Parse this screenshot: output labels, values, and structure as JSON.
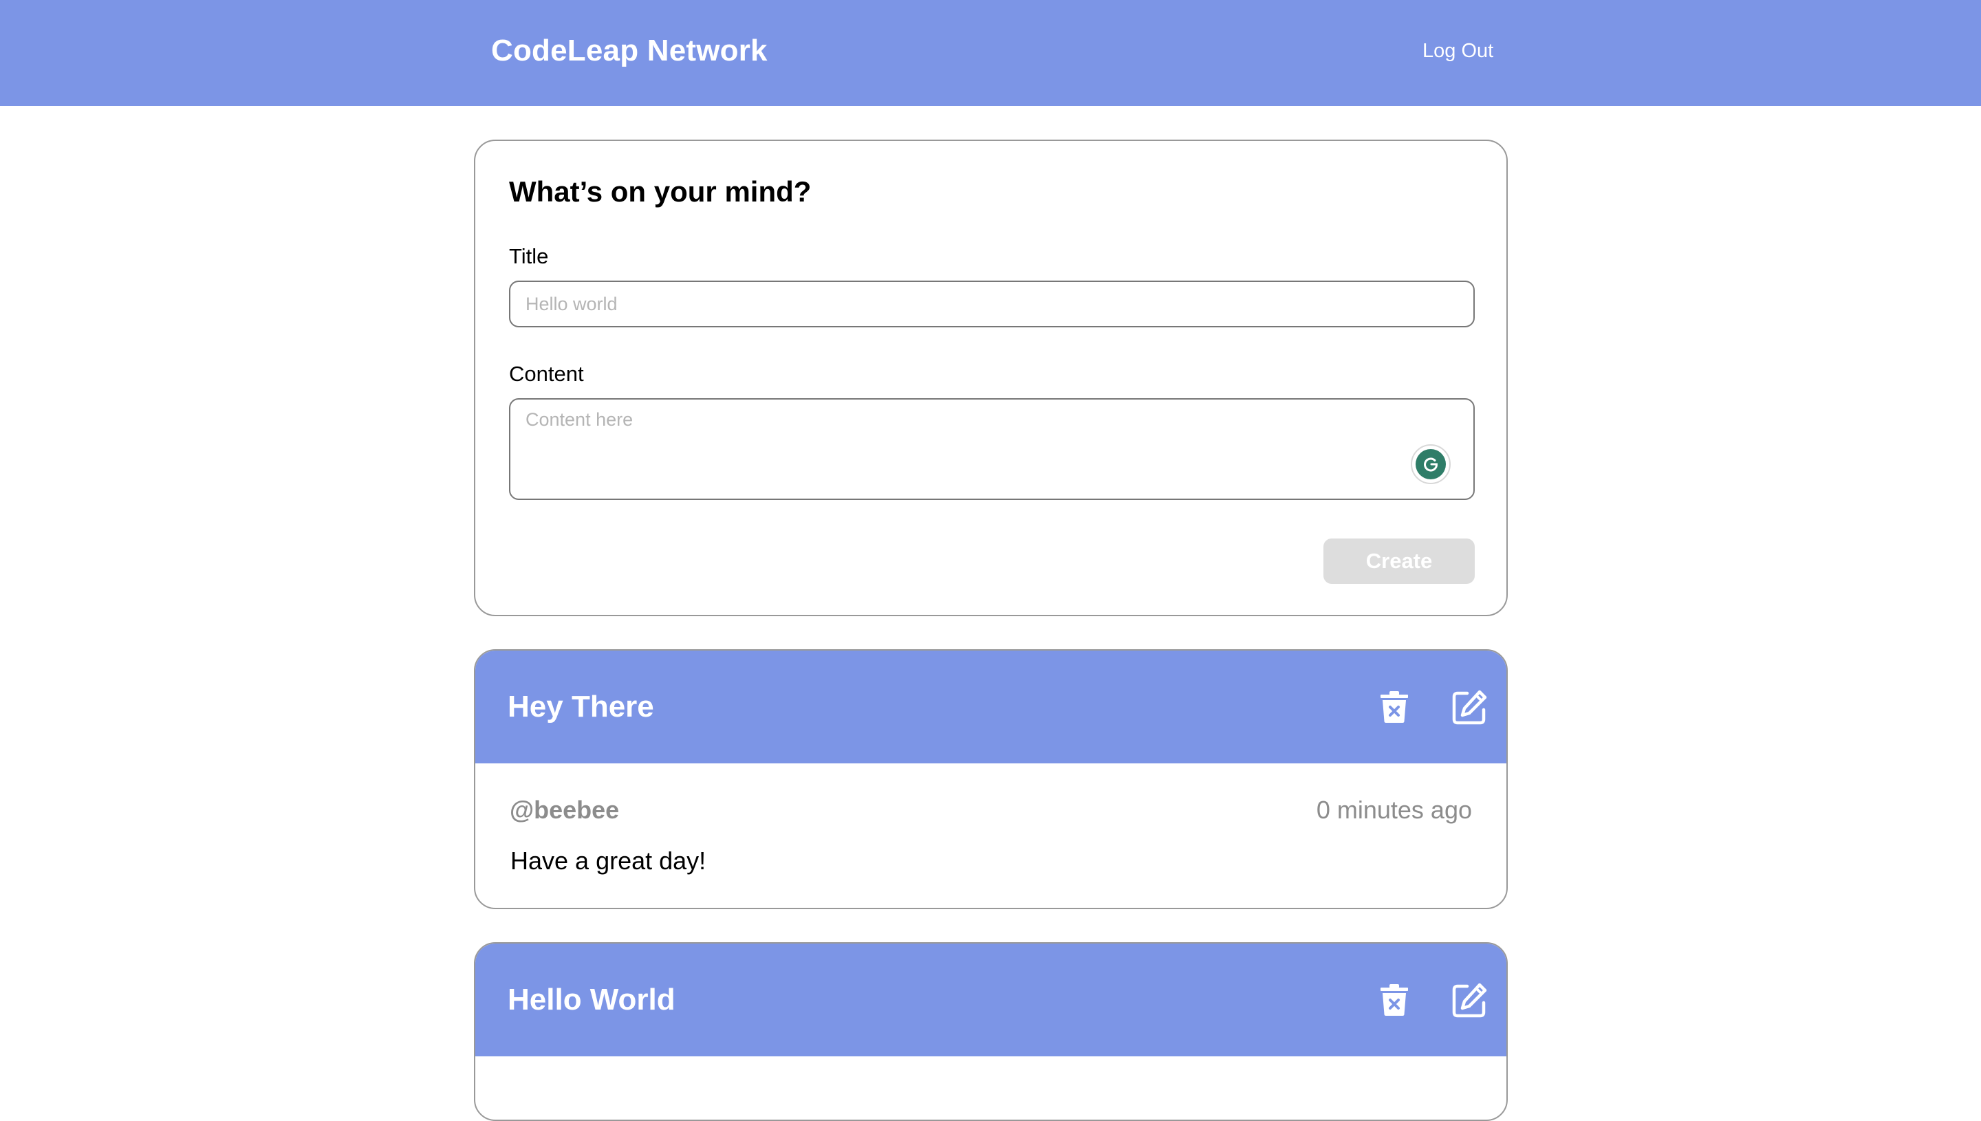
{
  "header": {
    "brand": "CodeLeap Network",
    "logout_label": "Log Out",
    "accent_color": "#7c95e6"
  },
  "composer": {
    "heading": "What’s on your mind?",
    "title_label": "Title",
    "title_placeholder": "Hello world",
    "title_value": "",
    "content_label": "Content",
    "content_placeholder": "Content here",
    "content_value": "",
    "create_label": "Create",
    "create_disabled": true
  },
  "posts": [
    {
      "title": "Hey There",
      "username": "@beebee",
      "time": "0 minutes ago",
      "content": "Have a great day!",
      "actions": [
        "trash-icon",
        "edit-icon"
      ]
    },
    {
      "title": "Hello World",
      "actions": [
        "trash-icon",
        "edit-icon"
      ]
    }
  ]
}
